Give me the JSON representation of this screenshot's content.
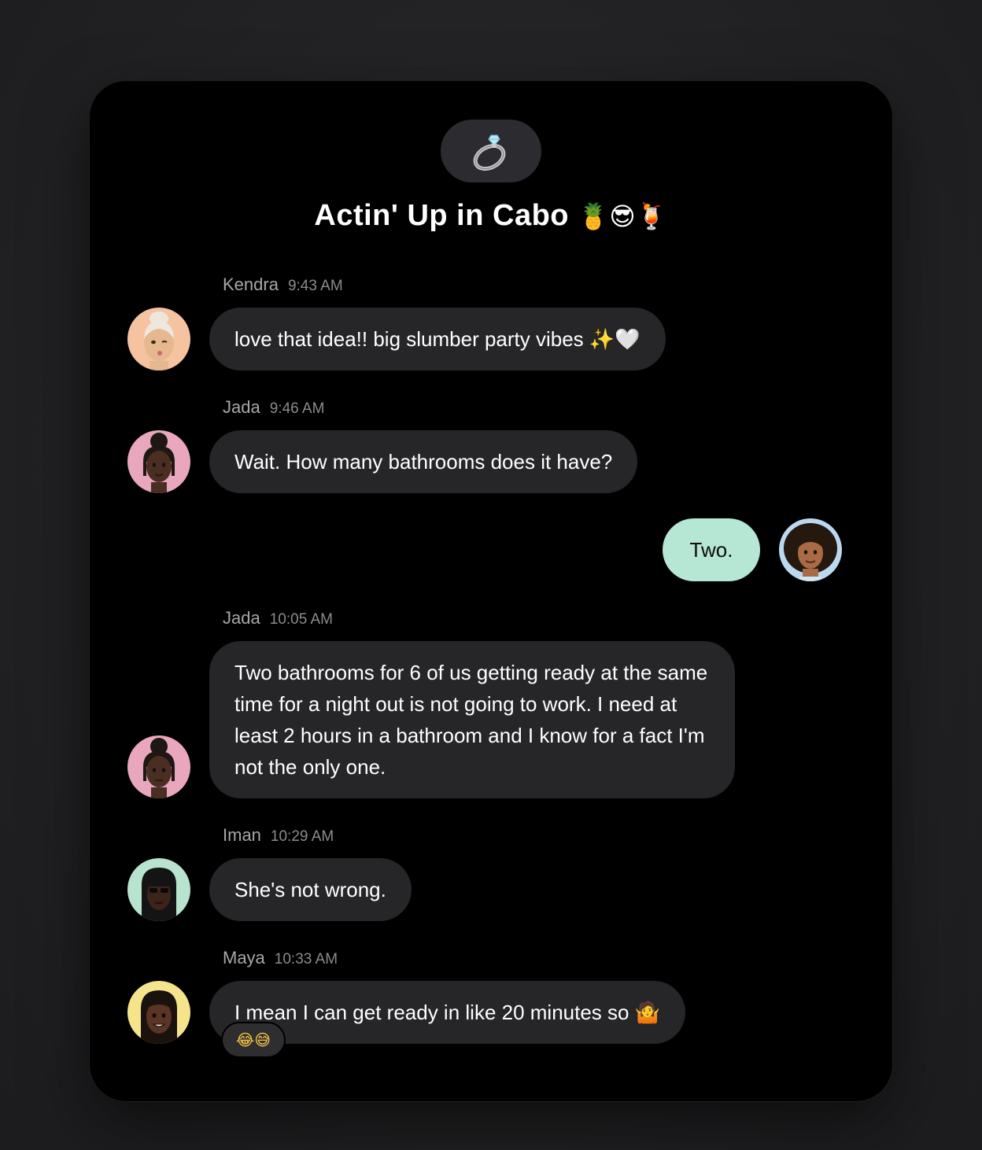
{
  "chat": {
    "title": "Actin' Up in Cabo",
    "title_emojis": "🍍😎🍹",
    "group_icon": "ring-icon"
  },
  "messages": [
    {
      "sender": "Kendra",
      "time": "9:43 AM",
      "text": "love that idea!! big slumber party vibes",
      "emoji": "✨🤍",
      "avatar_color": "#f6c3a0",
      "mine": false
    },
    {
      "sender": "Jada",
      "time": "9:46 AM",
      "text": "Wait. How many bathrooms does it have?",
      "avatar_color": "#e9a7bd",
      "mine": false
    },
    {
      "sender": "",
      "time": "",
      "text": "Two.",
      "avatar_color": "#bcd8ef",
      "mine": true
    },
    {
      "sender": "Jada",
      "time": "10:05 AM",
      "text": "Two bathrooms for 6 of us getting ready at the same time for a night out is not going to work. I need at least 2 hours in a bathroom and I know for a fact I'm not the only one.",
      "avatar_color": "#e9a7bd",
      "mine": false
    },
    {
      "sender": "Iman",
      "time": "10:29 AM",
      "text": "She's not wrong.",
      "avatar_color": "#b8e3cf",
      "mine": false
    },
    {
      "sender": "Maya",
      "time": "10:33 AM",
      "text": "I mean I can get ready in like 20 minutes so",
      "emoji": "🤷",
      "avatar_color": "#f6e48c",
      "mine": false,
      "reactions": "😂😅"
    }
  ],
  "colors": {
    "background": "#1c1c1e",
    "card": "#000000",
    "bubble_incoming": "#262628",
    "bubble_outgoing": "#b6e6d4",
    "meta_text": "#a7a7ab"
  }
}
